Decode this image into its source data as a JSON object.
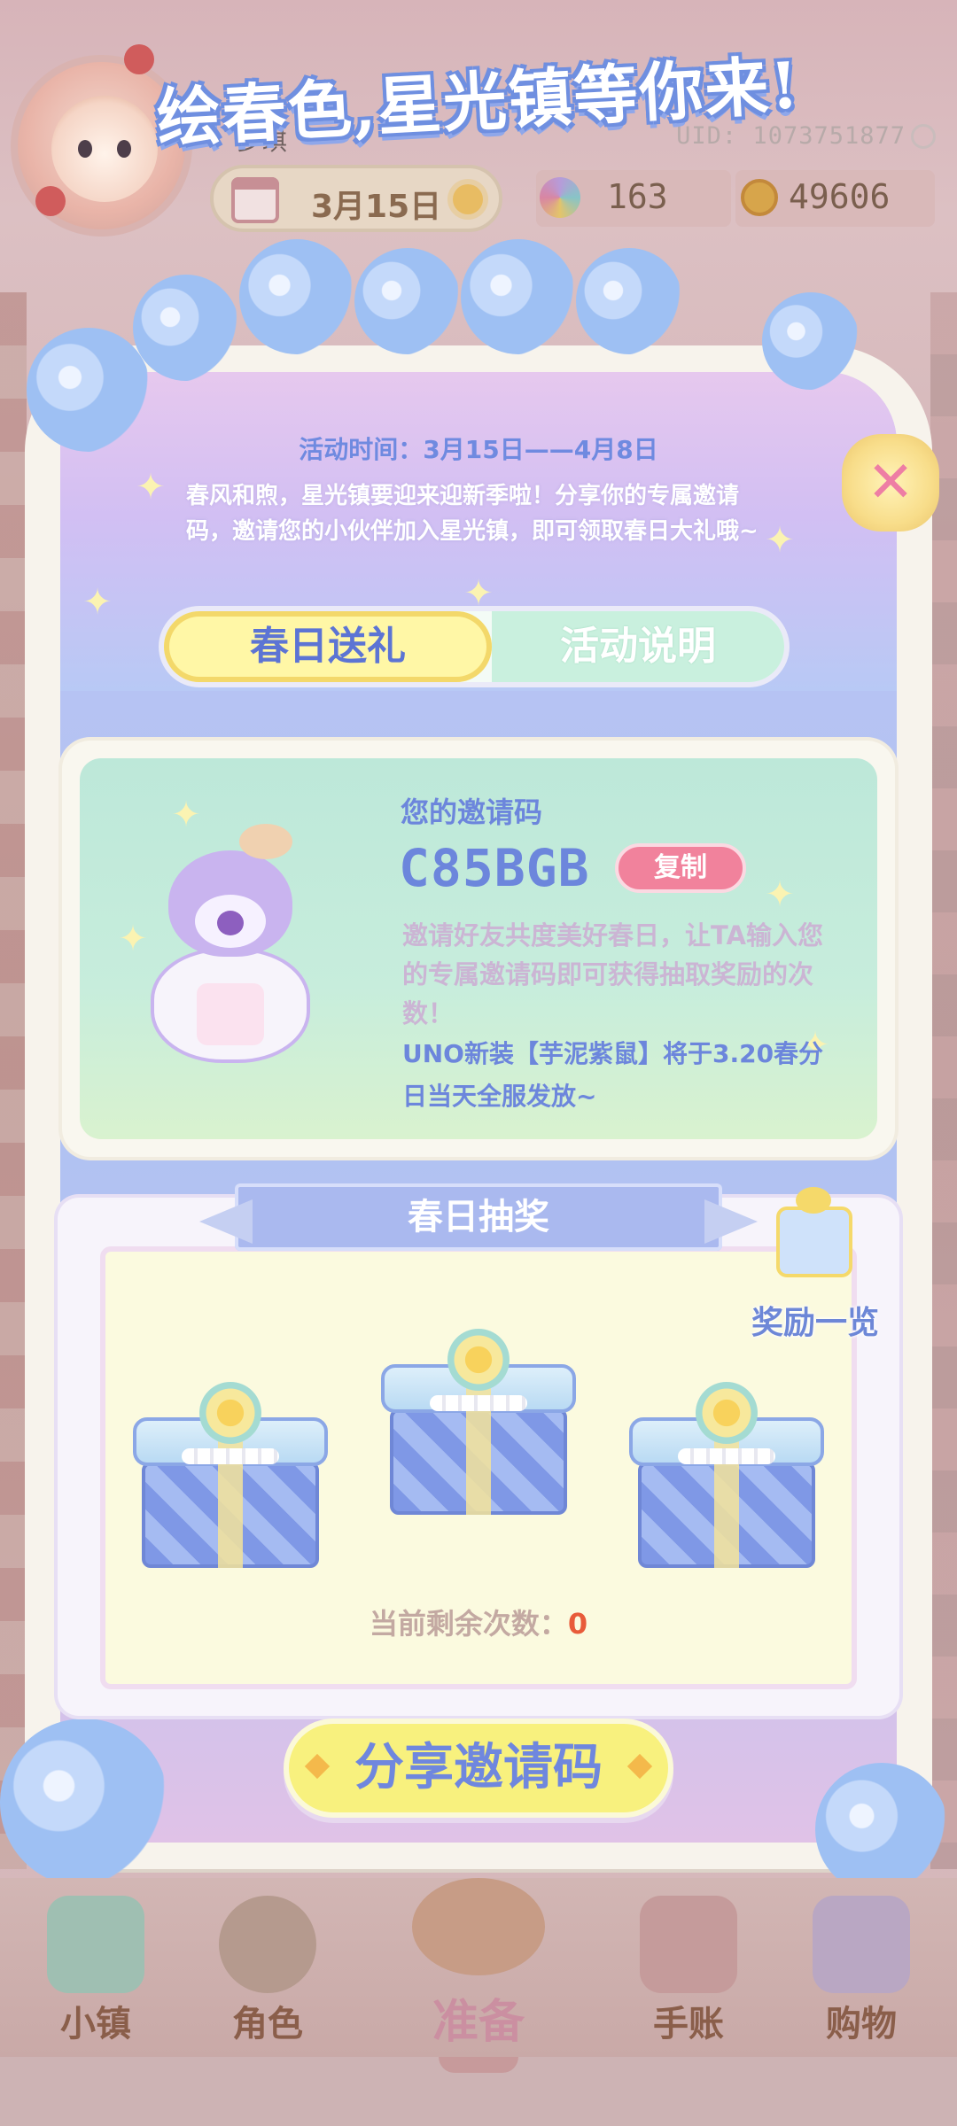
{
  "player": {
    "name": "少琪",
    "uid": "UID: 1073751877"
  },
  "topbar": {
    "date": "3月15日",
    "gems": "163",
    "coins": "49606"
  },
  "event": {
    "title": "绘春色,星光镇等你来!",
    "time": "活动时间：3月15日——4月8日",
    "intro": "春风和煦，星光镇要迎来迎新季啦！分享你的专属邀请码，邀请您的小伙伴加入星光镇，即可领取春日大礼哦~"
  },
  "tabs": [
    {
      "label": "春日送礼",
      "active": true
    },
    {
      "label": "活动说明",
      "active": false
    }
  ],
  "invite": {
    "label": "您的邀请码",
    "code": "C85BGB",
    "copy_label": "复制",
    "description": "邀请好友共度美好春日，让TA输入您的专属邀请码即可获得抽取奖励的次数！",
    "news": "UNO新装【芋泥紫鼠】将于3.20春分日当天全服发放~"
  },
  "lottery": {
    "title": "春日抽奖",
    "reward_list_label": "奖励一览",
    "remaining_label": "当前剩余次数：",
    "remaining_count": "0"
  },
  "share_button_label": "分享邀请码",
  "nav": [
    {
      "label": "小镇",
      "icon": "map-icon"
    },
    {
      "label": "角色",
      "icon": "character-icon"
    },
    {
      "label": "准备",
      "icon": "prepare-icon",
      "active": true
    },
    {
      "label": "手账",
      "icon": "journal-icon"
    },
    {
      "label": "购物",
      "icon": "shopping-bag-icon"
    }
  ],
  "colors": {
    "accent_blue": "#6c86dc",
    "tab_active_bg": "#fff7a6",
    "copy_button": "#f1829c",
    "remaining_count": "#e85b3a"
  }
}
